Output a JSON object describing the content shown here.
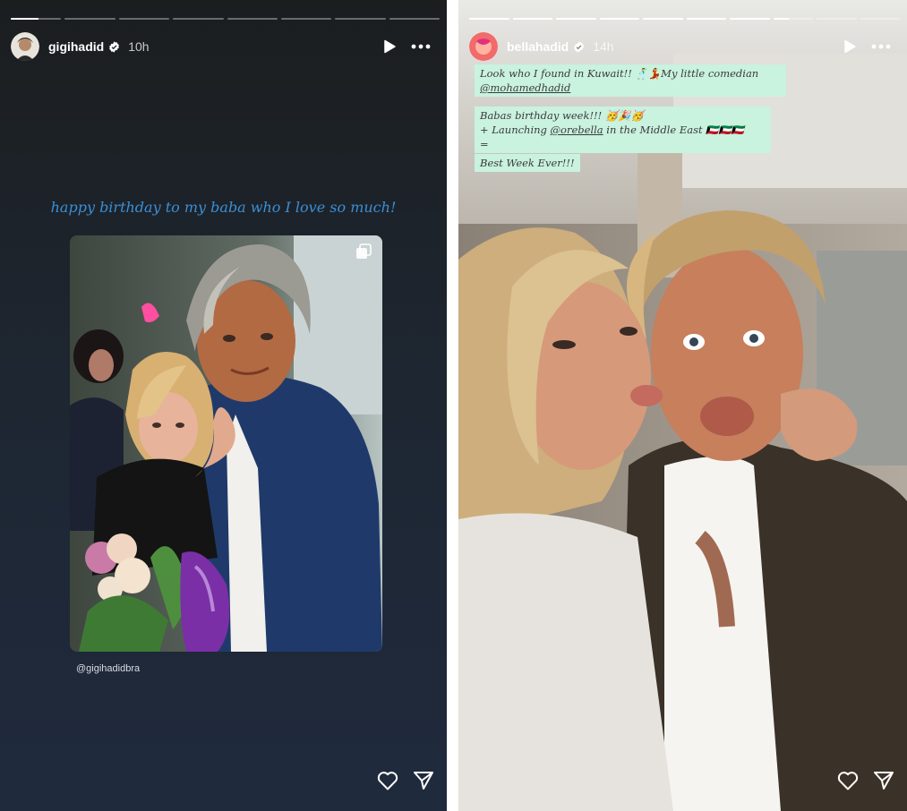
{
  "left_story": {
    "progress_segments": [
      1,
      0,
      0,
      0,
      0,
      0,
      0,
      0
    ],
    "progress_active_fill": 0.55,
    "username": "gigihadid",
    "time": "10h",
    "caption": "happy birthday to my baba who I love so much!",
    "photo_credit": "@gigihadidbra",
    "colors": {
      "caption": "#3a8fd6",
      "background_top": "#1b1e1f",
      "background_bottom": "#1f2a3d"
    }
  },
  "right_story": {
    "progress_segments": [
      1,
      1,
      1,
      1,
      1,
      1,
      1,
      0.4,
      0,
      0
    ],
    "username": "bellahadid",
    "time": "14h",
    "sticker1": {
      "text": "Look who I found in Kuwait!! 🕺💃My little comedian",
      "mention": "@mohamedhadid"
    },
    "sticker2": {
      "line1": "Babas birthday week!!! 🥳🎉🥳",
      "line2_prefix": "+ Launching ",
      "line2_mention": "@orebella",
      "line2_suffix": " in the Middle East 🇰🇼🇰🇼🇰🇼",
      "line3": "=",
      "line4": "Best Week Ever!!!"
    },
    "colors": {
      "sticker_bg": "#c9f2df"
    }
  },
  "icons": [
    "verified-icon",
    "play-icon",
    "more-icon",
    "heart-icon",
    "share-icon"
  ]
}
